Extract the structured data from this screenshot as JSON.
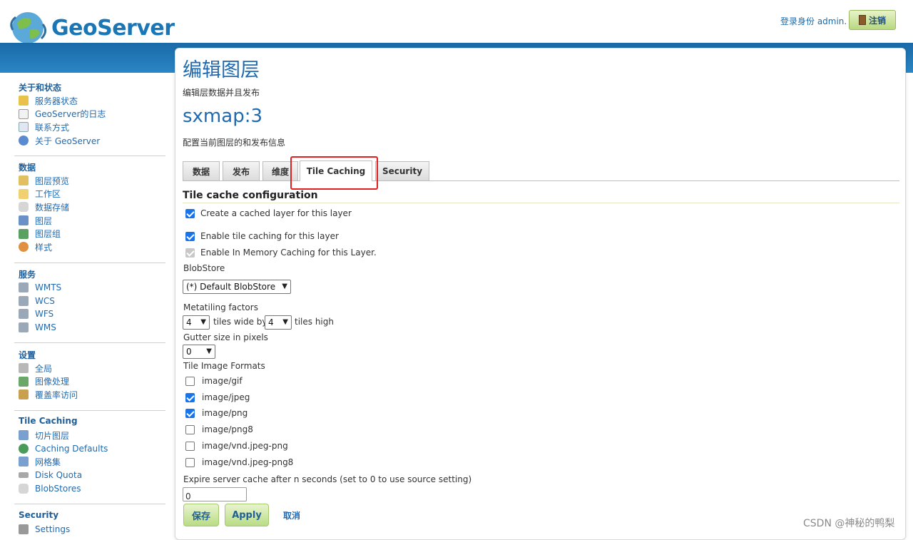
{
  "header": {
    "logo_text": "GeoServer",
    "login_text": "登录身份 admin.",
    "logout_label": "注销"
  },
  "sidebar": {
    "sections": [
      {
        "title": "关于和状态",
        "items": [
          "服务器状态",
          "GeoServer的日志",
          "联系方式",
          "关于 GeoServer"
        ]
      },
      {
        "title": "数据",
        "items": [
          "图层预览",
          "工作区",
          "数据存储",
          "图层",
          "图层组",
          "样式"
        ]
      },
      {
        "title": "服务",
        "items": [
          "WMTS",
          "WCS",
          "WFS",
          "WMS"
        ]
      },
      {
        "title": "设置",
        "items": [
          "全局",
          "图像处理",
          "覆盖率访问"
        ]
      },
      {
        "title": "Tile Caching",
        "items": [
          "切片图层",
          "Caching Defaults",
          "网格集",
          "Disk Quota",
          "BlobStores"
        ]
      },
      {
        "title": "Security",
        "items": [
          "Settings"
        ]
      }
    ]
  },
  "main": {
    "title": "编辑图层",
    "subtitle": "编辑层数据并且发布",
    "layer_name": "sxmap:3",
    "layer_desc": "配置当前图层的和发布信息",
    "tabs": [
      "数据",
      "发布",
      "维度",
      "Tile Caching",
      "Security"
    ],
    "active_tab": "Tile Caching",
    "section_title": "Tile cache configuration",
    "create_cached_layer": "Create a cached layer for this layer",
    "enable_tile_caching": "Enable tile caching for this layer",
    "enable_memory_caching": "Enable In Memory Caching for this Layer.",
    "blobstore_label": "BlobStore",
    "blobstore_value": "(*) Default BlobStore",
    "metatiling_label": "Metatiling factors",
    "metatile_wide": "4",
    "tiles_wide_by": "tiles wide by",
    "metatile_high": "4",
    "tiles_high": "tiles high",
    "gutter_label": "Gutter size in pixels",
    "gutter_value": "0",
    "formats_label": "Tile Image Formats",
    "formats": [
      {
        "name": "image/gif",
        "checked": false
      },
      {
        "name": "image/jpeg",
        "checked": true
      },
      {
        "name": "image/png",
        "checked": true
      },
      {
        "name": "image/png8",
        "checked": false
      },
      {
        "name": "image/vnd.jpeg-png",
        "checked": false
      },
      {
        "name": "image/vnd.jpeg-png8",
        "checked": false
      }
    ],
    "expire_label": "Expire server cache after n seconds (set to 0 to use source setting)",
    "expire_value": "0",
    "save_label": "保存",
    "apply_label": "Apply",
    "cancel_label": "取消"
  },
  "watermark": "CSDN @神秘的鸭梨",
  "colors": {
    "accent": "#1f6ab0",
    "band": "#2b86c4",
    "highlight": "#e02020",
    "button": "#b9dc84"
  }
}
